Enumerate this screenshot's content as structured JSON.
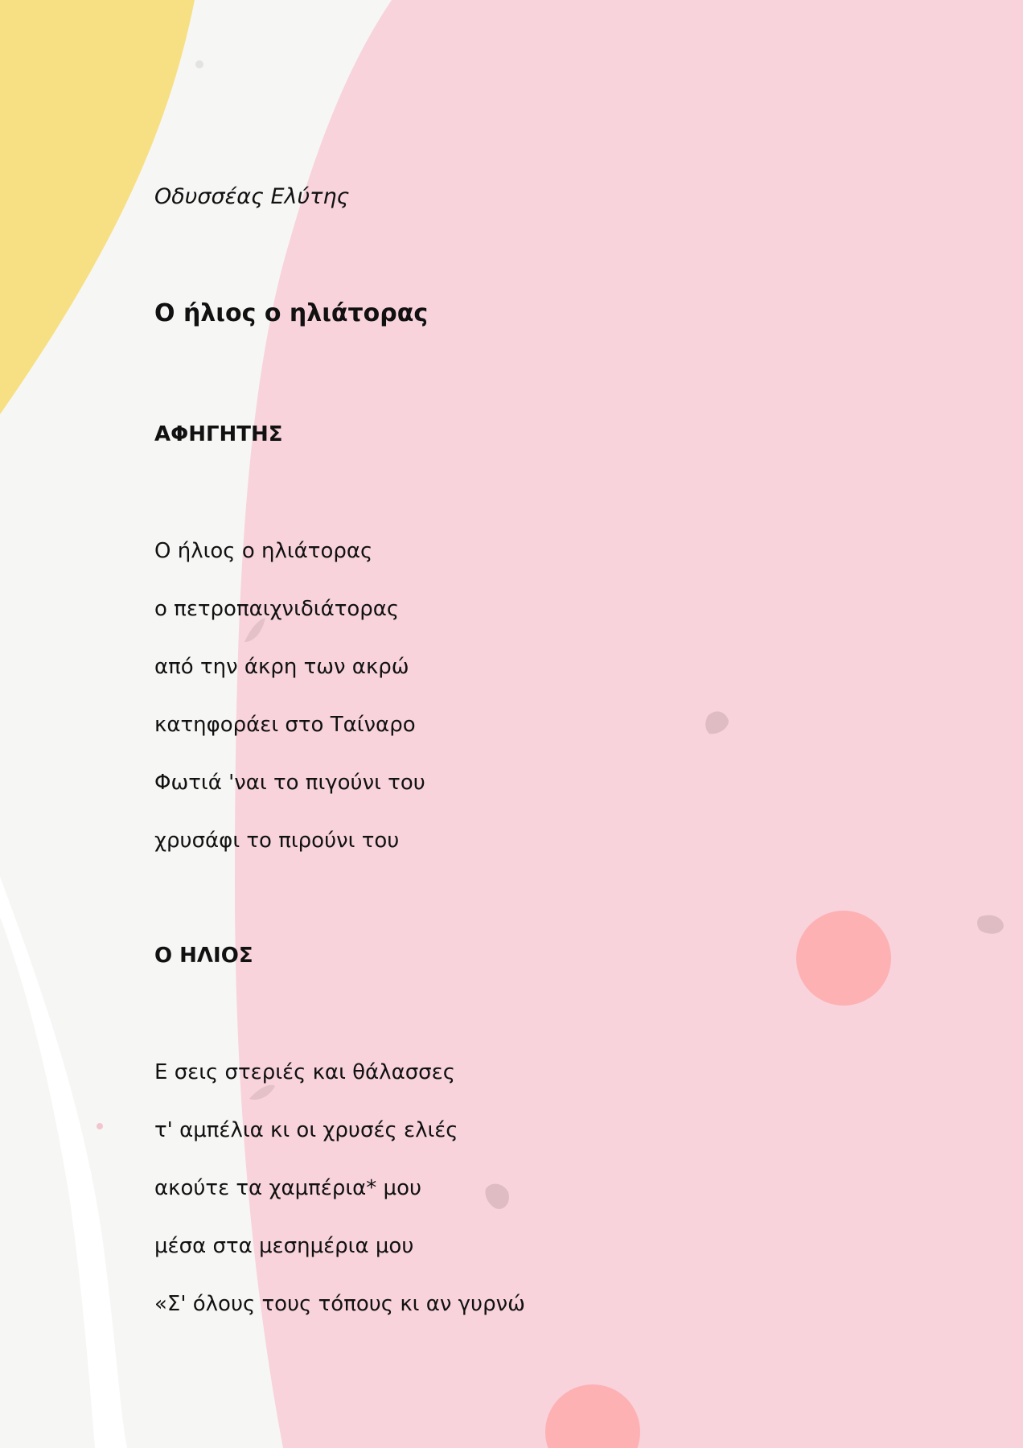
{
  "author": "Οδυσσέας Ελύτης",
  "title": "Ο ήλιος ο ηλιάτορας",
  "sections": [
    {
      "speaker": "ΑΦΗΓΗΤΗΣ",
      "lines": [
        "Ο ήλιος ο ηλιάτορας",
        "ο πετροπαιχνιδιάτορας",
        "από την άκρη των ακρώ",
        "κατηφοράει στο Ταίναρο",
        "Φωτιά 'ναι το πιγούνι του",
        "χρυσάφι το πιρούνι του"
      ]
    },
    {
      "speaker": "Ο ΗΛΙΟΣ",
      "lines": [
        "Ε σεις στεριές και θάλασσες",
        "τ' αμπέλια κι οι χρυσές ελιές",
        "ακούτε τα χαμπέρια* μου",
        "μέσα στα μεσημέρια μου",
        "«Σ' όλους τους τόπους κι αν γυρνώ"
      ]
    }
  ],
  "colors": {
    "paper": "#f6f6f5",
    "yellow": "#f7e083",
    "pink": "#f8d3dc",
    "dot": "#fdb1b3",
    "speck": "#dfbbc3"
  }
}
